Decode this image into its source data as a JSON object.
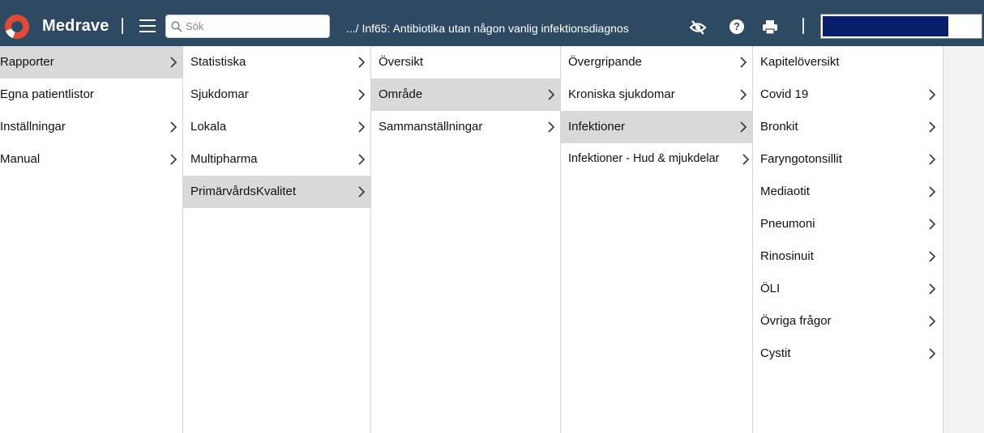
{
  "header": {
    "brand": "Medrave",
    "search_placeholder": "Sök",
    "breadcrumb": ".../ Inf65: Antibiotika utan någon vanlig infektionsdiagnos",
    "help_label": "?"
  },
  "colors": {
    "topbar": "#2e4a62",
    "active_item": "#d9d9d9",
    "logo_accent": "#e04a37"
  },
  "menus": {
    "col1": {
      "items": [
        {
          "label": "Rapporter",
          "has_submenu": true,
          "active": true
        },
        {
          "label": "Egna patientlistor",
          "has_submenu": false,
          "active": false
        },
        {
          "label": "Inställningar",
          "has_submenu": true,
          "active": false
        },
        {
          "label": "Manual",
          "has_submenu": true,
          "active": false
        }
      ]
    },
    "col2": {
      "items": [
        {
          "label": "Statistiska",
          "has_submenu": true,
          "active": false
        },
        {
          "label": "Sjukdomar",
          "has_submenu": true,
          "active": false
        },
        {
          "label": "Lokala",
          "has_submenu": true,
          "active": false
        },
        {
          "label": "Multipharma",
          "has_submenu": true,
          "active": false
        },
        {
          "label": "PrimärvårdsKvalitet",
          "has_submenu": true,
          "active": true
        }
      ]
    },
    "col3": {
      "items": [
        {
          "label": "Översikt",
          "has_submenu": false,
          "active": false
        },
        {
          "label": "Område",
          "has_submenu": true,
          "active": true
        },
        {
          "label": "Sammanställningar",
          "has_submenu": true,
          "active": false
        }
      ]
    },
    "col4": {
      "items": [
        {
          "label": "Övergripande",
          "has_submenu": true,
          "active": false
        },
        {
          "label": "Kroniska sjukdomar",
          "has_submenu": true,
          "active": false
        },
        {
          "label": "Infektioner",
          "has_submenu": true,
          "active": true
        },
        {
          "label": "Infektioner - Hud & mjukdelar",
          "has_submenu": true,
          "active": false
        }
      ]
    },
    "col5": {
      "items": [
        {
          "label": "Kapitelöversikt",
          "has_submenu": false,
          "active": false
        },
        {
          "label": "Covid 19",
          "has_submenu": true,
          "active": false
        },
        {
          "label": "Bronkit",
          "has_submenu": true,
          "active": false
        },
        {
          "label": "Faryngotonsillit",
          "has_submenu": true,
          "active": false
        },
        {
          "label": "Mediaotit",
          "has_submenu": true,
          "active": false
        },
        {
          "label": "Pneumoni",
          "has_submenu": true,
          "active": false
        },
        {
          "label": "Rinosinuit",
          "has_submenu": true,
          "active": false
        },
        {
          "label": "ÖLI",
          "has_submenu": true,
          "active": false
        },
        {
          "label": "Övriga frågor",
          "has_submenu": true,
          "active": false
        },
        {
          "label": "Cystit",
          "has_submenu": true,
          "active": false
        }
      ]
    }
  }
}
